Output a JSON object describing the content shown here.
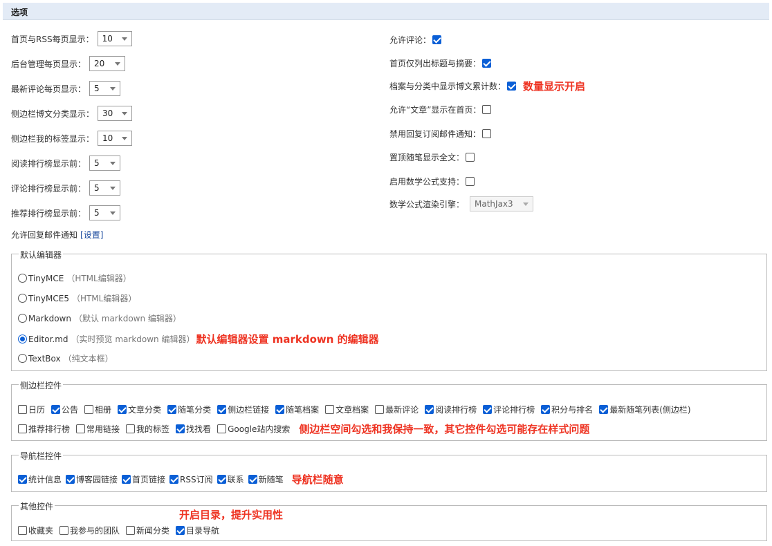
{
  "title": "选项",
  "left_options": [
    {
      "label": "首页与RSS每页显示：",
      "value": "10"
    },
    {
      "label": "后台管理每页显示：",
      "value": "20"
    },
    {
      "label": "最新评论每页显示：",
      "value": "5"
    },
    {
      "label": "侧边栏博文分类显示：",
      "value": "30"
    },
    {
      "label": "侧边栏我的标签显示：",
      "value": "10"
    },
    {
      "label": "阅读排行榜显示前：",
      "value": "5"
    },
    {
      "label": "评论排行榜显示前：",
      "value": "5"
    },
    {
      "label": "推荐排行榜显示前：",
      "value": "5"
    }
  ],
  "reply_notify": {
    "label": "允许回复邮件通知",
    "link": "[设置]"
  },
  "right_options": [
    {
      "label": "允许评论：",
      "checked": true
    },
    {
      "label": "首页仅列出标题与摘要：",
      "checked": true
    },
    {
      "label": "档案与分类中显示博文累计数：",
      "checked": true
    },
    {
      "label": "允许“文章”显示在首页：",
      "checked": false
    },
    {
      "label": "禁用回复订阅邮件通知：",
      "checked": false
    },
    {
      "label": "置顶随笔显示全文：",
      "checked": false
    },
    {
      "label": "启用数学公式支持：",
      "checked": false
    }
  ],
  "count_note": "数量显示开启",
  "math_engine": {
    "label": "数学公式渲染引擎：",
    "value": "MathJax3"
  },
  "editor": {
    "legend": "默认编辑器",
    "options": [
      {
        "name": "TinyMCE",
        "desc": "（HTML编辑器）",
        "selected": false
      },
      {
        "name": "TinyMCE5",
        "desc": "（HTML编辑器）",
        "selected": false
      },
      {
        "name": "Markdown",
        "desc": "（默认 markdown 编辑器）",
        "selected": false
      },
      {
        "name": "Editor.md",
        "desc": "（实时预览 markdown 编辑器）",
        "selected": true
      },
      {
        "name": "TextBox",
        "desc": "（纯文本框）",
        "selected": false
      }
    ],
    "note": "默认编辑器设置 markdown 的编辑器"
  },
  "sidebar": {
    "legend": "侧边栏控件",
    "row1": [
      {
        "label": "日历",
        "checked": false
      },
      {
        "label": "公告",
        "checked": true
      },
      {
        "label": "相册",
        "checked": false
      },
      {
        "label": "文章分类",
        "checked": true
      },
      {
        "label": "随笔分类",
        "checked": true
      },
      {
        "label": "侧边栏链接",
        "checked": true
      },
      {
        "label": "随笔档案",
        "checked": true
      },
      {
        "label": "文章档案",
        "checked": false
      },
      {
        "label": "最新评论",
        "checked": false
      },
      {
        "label": "阅读排行榜",
        "checked": true
      },
      {
        "label": "评论排行榜",
        "checked": true
      },
      {
        "label": "积分与排名",
        "checked": true
      },
      {
        "label": "最新随笔列表(侧边栏)",
        "checked": true
      }
    ],
    "row2": [
      {
        "label": "推荐排行榜",
        "checked": false
      },
      {
        "label": "常用链接",
        "checked": false
      },
      {
        "label": "我的标签",
        "checked": false
      },
      {
        "label": "找找看",
        "checked": true
      },
      {
        "label": "Google站内搜索",
        "checked": false
      }
    ],
    "note": "侧边栏空间勾选和我保持一致，其它控件勾选可能存在样式问题"
  },
  "navbar": {
    "legend": "导航栏控件",
    "items": [
      {
        "label": "统计信息",
        "checked": true
      },
      {
        "label": "博客园链接",
        "checked": true
      },
      {
        "label": "首页链接",
        "checked": true
      },
      {
        "label": "RSS订阅",
        "checked": true
      },
      {
        "label": "联系",
        "checked": true
      },
      {
        "label": "新随笔",
        "checked": true
      }
    ],
    "note": "导航栏随意"
  },
  "other": {
    "legend": "其他控件",
    "items": [
      {
        "label": "收藏夹",
        "checked": false
      },
      {
        "label": "我参与的团队",
        "checked": false
      },
      {
        "label": "新闻分类",
        "checked": false
      },
      {
        "label": "目录导航",
        "checked": true
      }
    ],
    "note": "开启目录，提升实用性"
  },
  "colors": {
    "accent": "#0b5fd6",
    "annotation": "#ee3322",
    "header_bg": "#e3ebf6"
  }
}
